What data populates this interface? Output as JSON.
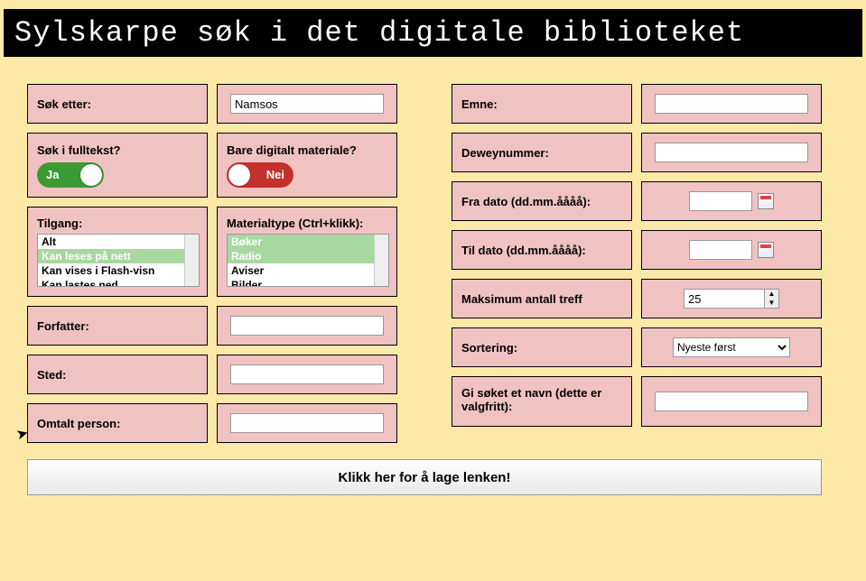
{
  "header": {
    "title": "Sylskarpe søk i det digitale biblioteket"
  },
  "left": {
    "sok_etter": {
      "label": "Søk etter:",
      "value": "Namsos"
    },
    "fulltekst": {
      "label": "Søk i fulltekst?",
      "on_text": "Ja",
      "state": "on"
    },
    "digitalt": {
      "label": "Bare digitalt materiale?",
      "off_text": "Nei",
      "state": "off"
    },
    "tilgang": {
      "label": "Tilgang:",
      "options": [
        "Alt",
        "Kan leses på nett",
        "Kan vises i Flash-visn",
        "Kan lastes ned"
      ],
      "selected": [
        "Kan leses på nett"
      ]
    },
    "materialtype": {
      "label": "Materialtype (Ctrl+klikk):",
      "options": [
        "Bøker",
        "Radio",
        "Aviser",
        "Bilder"
      ],
      "selected": [
        "Bøker",
        "Radio"
      ]
    },
    "forfatter": {
      "label": "Forfatter:",
      "value": ""
    },
    "sted": {
      "label": "Sted:",
      "value": ""
    },
    "omtalt": {
      "label": "Omtalt person:",
      "value": ""
    }
  },
  "right": {
    "emne": {
      "label": "Emne:",
      "value": ""
    },
    "dewey": {
      "label": "Deweynummer:",
      "value": ""
    },
    "fra_dato": {
      "label": "Fra dato (dd.mm.åååå):",
      "value": ""
    },
    "til_dato": {
      "label": "Til dato (dd.mm.åååå):",
      "value": ""
    },
    "maks": {
      "label": "Maksimum antall treff",
      "value": "25"
    },
    "sortering": {
      "label": "Sortering:",
      "value": "Nyeste først",
      "options": [
        "Nyeste først"
      ]
    },
    "navn": {
      "label": "Gi søket et navn (dette er valgfritt):",
      "value": ""
    }
  },
  "submit": {
    "label": "Klikk her for å lage lenken!"
  }
}
